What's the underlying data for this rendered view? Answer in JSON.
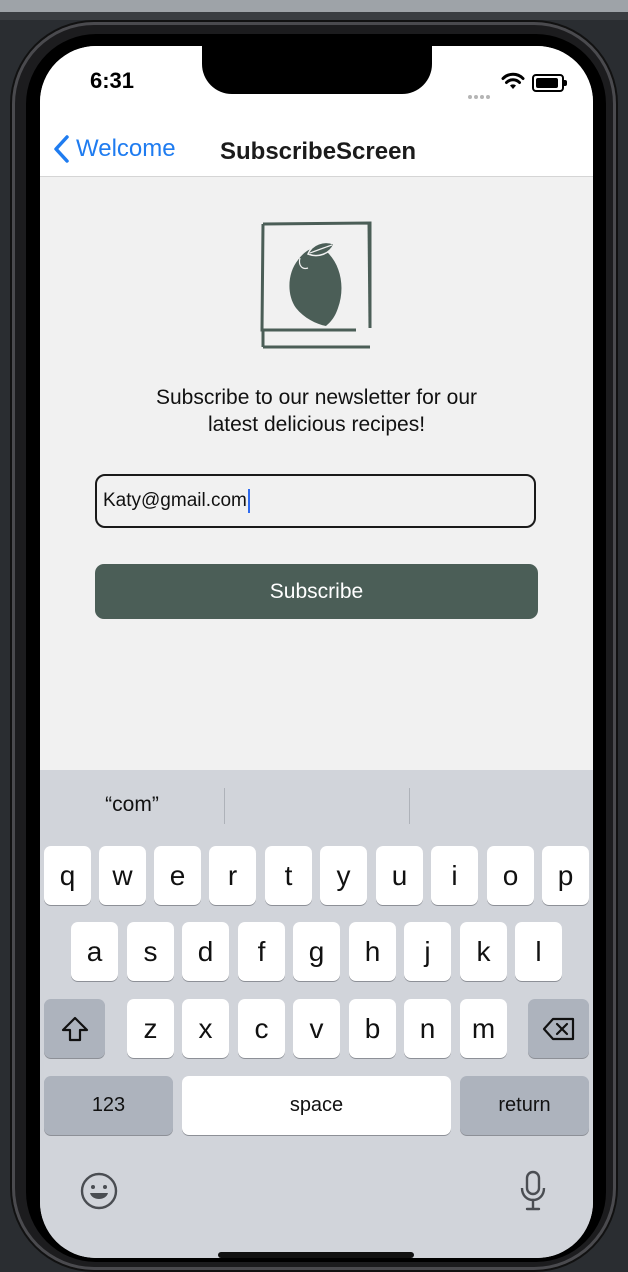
{
  "status": {
    "time": "6:31"
  },
  "nav": {
    "back_label": "Welcome",
    "title": "SubscribeScreen"
  },
  "content": {
    "tagline_line1": "Subscribe to our newsletter for our",
    "tagline_line2": "latest delicious recipes!",
    "email_value": "Katy@gmail.com",
    "subscribe_label": "Subscribe"
  },
  "keyboard": {
    "suggestions": [
      "“com”",
      "",
      ""
    ],
    "row1": [
      "q",
      "w",
      "e",
      "r",
      "t",
      "y",
      "u",
      "i",
      "o",
      "p"
    ],
    "row2": [
      "a",
      "s",
      "d",
      "f",
      "g",
      "h",
      "j",
      "k",
      "l"
    ],
    "row3": [
      "z",
      "x",
      "c",
      "v",
      "b",
      "n",
      "m"
    ],
    "numbers_label": "123",
    "space_label": "space",
    "return_label": "return"
  },
  "colors": {
    "accent_blue": "#1f7cf0",
    "brand_green": "#4b5e57",
    "keyboard_bg": "#d1d4da"
  },
  "icons": [
    "chevron-left-icon",
    "wifi-icon",
    "battery-icon",
    "lemon-logo-icon",
    "shift-icon",
    "backspace-icon",
    "emoji-icon",
    "microphone-icon"
  ]
}
